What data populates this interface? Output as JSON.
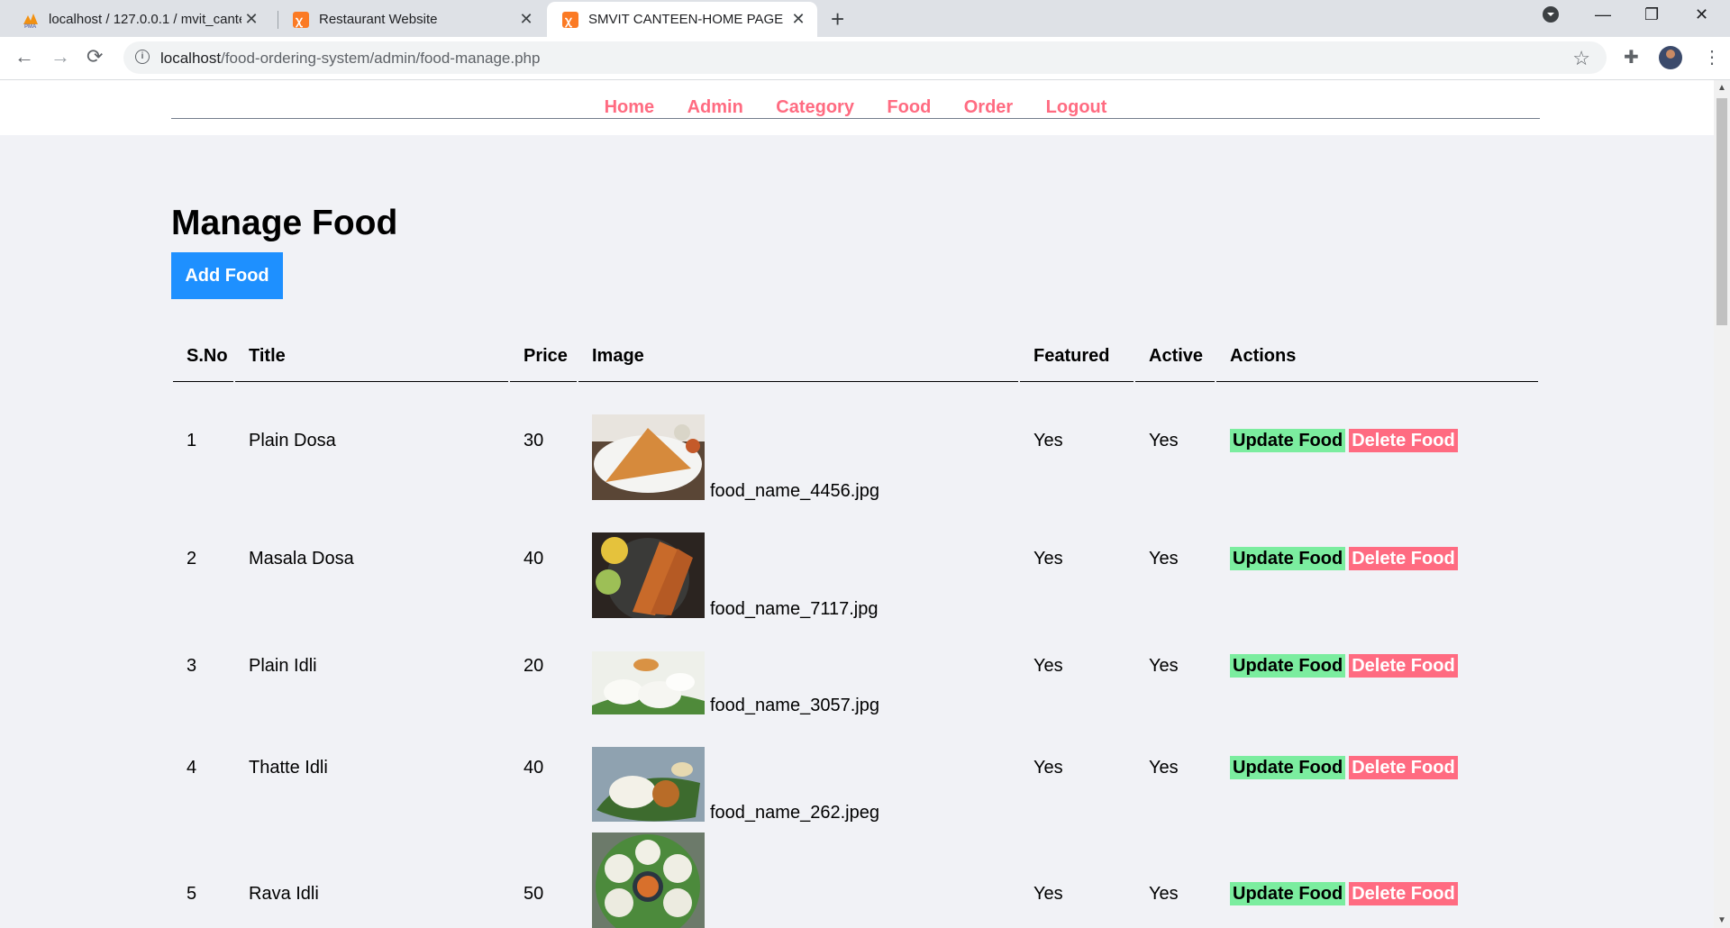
{
  "browser": {
    "tabs": [
      {
        "title": "localhost / 127.0.0.1 / mvit_canteen",
        "icon": "phpmyadmin-icon",
        "active": false
      },
      {
        "title": "Restaurant Website",
        "icon": "xampp-icon",
        "active": false
      },
      {
        "title": "SMVIT CANTEEN-HOME PAGE",
        "icon": "xampp-icon",
        "active": true
      }
    ],
    "url_host": "localhost",
    "url_path": "/food-ordering-system/admin/food-manage.php"
  },
  "nav": {
    "items": [
      "Home",
      "Admin",
      "Category",
      "Food",
      "Order",
      "Logout"
    ],
    "color": "#ff6b81"
  },
  "page": {
    "title": "Manage Food",
    "add_button": "Add Food",
    "accent": "#1e90ff"
  },
  "table": {
    "headers": {
      "sno": "S.No",
      "title": "Title",
      "price": "Price",
      "image": "Image",
      "featured": "Featured",
      "active": "Active",
      "actions": "Actions"
    },
    "rows": [
      {
        "sno": "1",
        "title": "Plain Dosa",
        "price": "30",
        "image": "food_name_4456.jpg",
        "featured": "Yes",
        "active": "Yes"
      },
      {
        "sno": "2",
        "title": "Masala Dosa",
        "price": "40",
        "image": "food_name_7117.jpg",
        "featured": "Yes",
        "active": "Yes"
      },
      {
        "sno": "3",
        "title": "Plain Idli",
        "price": "20",
        "image": "food_name_3057.jpg",
        "featured": "Yes",
        "active": "Yes"
      },
      {
        "sno": "4",
        "title": "Thatte Idli",
        "price": "40",
        "image": "food_name_262.jpeg",
        "featured": "Yes",
        "active": "Yes"
      },
      {
        "sno": "5",
        "title": "Rava Idli",
        "price": "50",
        "image": "",
        "featured": "Yes",
        "active": "Yes"
      }
    ],
    "update_label": "Update Food",
    "delete_label": "Delete Food"
  }
}
